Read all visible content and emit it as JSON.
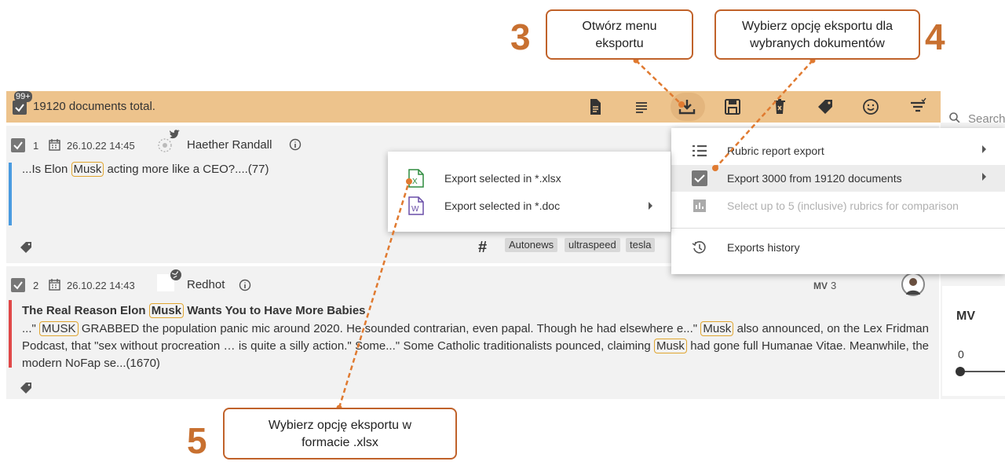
{
  "toolbar": {
    "badge": "99+",
    "total": "19120 documents total.",
    "icons": [
      "document-icon",
      "lines-icon",
      "download-icon",
      "save-icon",
      "delete-icon",
      "tag-icon",
      "smile-icon",
      "filter-icon"
    ]
  },
  "search": {
    "placeholder": "Search"
  },
  "right_panel": {
    "heading": "MV",
    "value": "0"
  },
  "documents": [
    {
      "number": "1",
      "date": "26.10.22 14:45",
      "author": "Haether Randall",
      "text_pre": "...Is Elon ",
      "text_hl": "Musk",
      "text_post": " acting more like a CEO?....(77)",
      "tags": [
        "Autonews",
        "ultraspeed",
        "tesla"
      ],
      "bar_color": "#4a9be0"
    },
    {
      "number": "2",
      "date": "26.10.22 14:43",
      "author": "Redhot",
      "mv": "MV",
      "mv_value": "3",
      "title_pre": "The Real Reason Elon ",
      "title_hl": "Musk",
      "title_post": " Wants You to Have More Babies",
      "t1": "...\" ",
      "h1": "MUSK",
      "t2": " GRABBED the population panic mic around 2020. He sounded contrarian, even papal. Though he had elsewhere e...\" ",
      "h2": "Musk",
      "t3": " also announced, on the Lex Fridman Podcast, that \"sex without procreation … is quite a silly action.\" Some...\" Some Catholic traditionalists pounced, claiming ",
      "h3": "Musk",
      "t4": " had gone full Humanae Vitae. Meanwhile, the modern NoFap se...(1670)",
      "bar_color": "#e04848"
    }
  ],
  "export_menu": {
    "items": [
      {
        "label": "Rubric report export"
      },
      {
        "label": "Export 3000 from 19120 documents"
      },
      {
        "label": "Select up to 5 (inclusive) rubrics for comparison"
      },
      {
        "label": "Exports history"
      }
    ]
  },
  "submenu": {
    "items": [
      {
        "label": "Export selected in *.xlsx"
      },
      {
        "label": "Export selected in *.doc"
      }
    ]
  },
  "annotations": {
    "step3": {
      "number": "3",
      "line1": "Otwórz menu",
      "line2": "eksportu"
    },
    "step4": {
      "number": "4",
      "line1": "Wybierz opcję eksportu dla",
      "line2": "wybranych dokumentów"
    },
    "step5": {
      "number": "5",
      "line1": "Wybierz opcję eksportu w",
      "line2": "formacie .xlsx"
    }
  },
  "colors": {
    "toolbar": "#edc38c",
    "annotation": "#c87030",
    "highlight": "#e0a530"
  }
}
